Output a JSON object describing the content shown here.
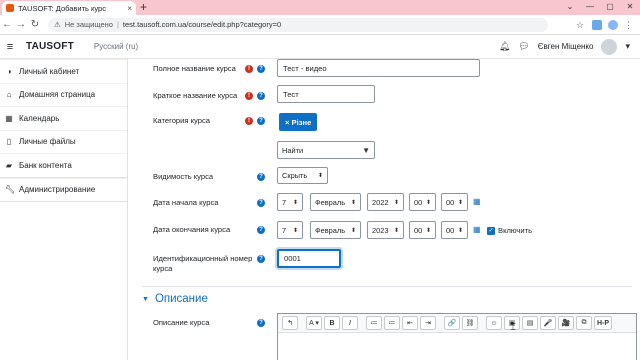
{
  "browser": {
    "tab_title": "TAUSOFT: Добавить курс",
    "tab_close": "×",
    "new_tab": "+",
    "insecure_label": "Не защищено",
    "url": "test.tausoft.com.ua/course/edit.php?category=0"
  },
  "navbar": {
    "brand": "TAUSOFT",
    "language": "Русский (ru)",
    "user_name": "Євген Міщенко"
  },
  "sidebar": {
    "items": [
      {
        "label": "Личный кабинет",
        "icon": "dashboard-icon"
      },
      {
        "label": "Домашняя страница",
        "icon": "home-icon"
      },
      {
        "label": "Календарь",
        "icon": "calendar-icon"
      },
      {
        "label": "Личные файлы",
        "icon": "file-icon"
      },
      {
        "label": "Банк контента",
        "icon": "content-bank-icon"
      }
    ],
    "admin": {
      "label": "Администрирование",
      "icon": "wrench-icon"
    }
  },
  "form": {
    "fullname": {
      "label": "Полное название курса",
      "value": "Тест - видео"
    },
    "shortname": {
      "label": "Краткое название курса",
      "value": "Тест"
    },
    "category": {
      "label": "Категория курса",
      "chip": "× Різне",
      "search_placeholder": "Найти"
    },
    "visibility": {
      "label": "Видимость курса",
      "value": "Скрыть"
    },
    "startdate": {
      "label": "Дата начала курса",
      "day": "7",
      "month": "Февраль",
      "year": "2022",
      "hour": "00",
      "minute": "00"
    },
    "enddate": {
      "label": "Дата окончания курса",
      "day": "7",
      "month": "Февраль",
      "year": "2023",
      "hour": "00",
      "minute": "00",
      "enable_label": "Включить"
    },
    "idnumber": {
      "label": "Идентификационный номер курса",
      "value": "0001"
    },
    "section_title": "Описание",
    "summary": {
      "label": "Описание курса"
    }
  },
  "editor": {
    "buttons": [
      "↰",
      "A ▾",
      "B",
      "I",
      "≔",
      "≔",
      "⇤",
      "⇥",
      "🔗",
      "⛓",
      "☺",
      "▣",
      "▤",
      "🎤",
      "🎥",
      "⧉",
      "H-P"
    ]
  },
  "colors": {
    "accent": "#0f6fc5",
    "required": "#ca3120",
    "tabstrip": "#f7c6cf"
  }
}
